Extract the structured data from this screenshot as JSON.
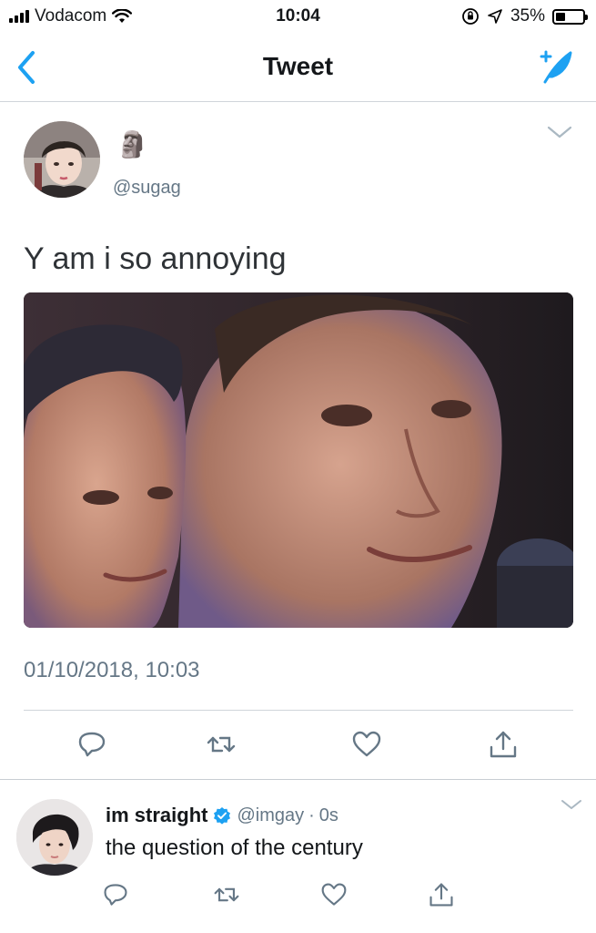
{
  "status_bar": {
    "carrier": "Vodacom",
    "time": "10:04",
    "battery": "35%",
    "battery_level": 0.35
  },
  "nav": {
    "title": "Tweet",
    "back_icon": "chevron-left-icon",
    "compose_icon": "compose-feather-icon"
  },
  "tweet": {
    "name": "🗿",
    "handle": "@sugag",
    "text": "Y am i so annoying",
    "timestamp": "01/10/2018, 10:03",
    "media_desc": "photo",
    "actions": [
      "reply-icon",
      "retweet-icon",
      "like-icon",
      "share-icon"
    ]
  },
  "reply": {
    "name": "im straight",
    "verified": true,
    "handle": "@imgay",
    "separator": "·",
    "time": "0s",
    "text": "the question of the century",
    "actions": [
      "reply-icon",
      "retweet-icon",
      "like-icon",
      "share-icon"
    ]
  },
  "colors": {
    "accent": "#1da1f2",
    "text": "#14171a",
    "secondary": "#657786",
    "divider": "#d0d5da"
  }
}
